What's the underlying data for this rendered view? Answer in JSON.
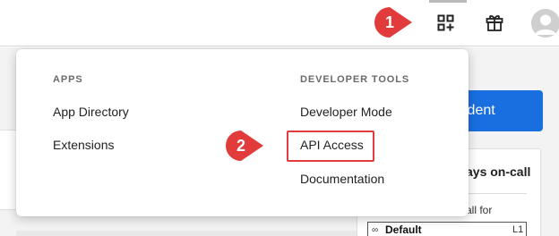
{
  "colors": {
    "accent_blue": "#1a6fe0",
    "callout_red": "#e23b3b",
    "section_gray": "#6a6a6a"
  },
  "topbar": {
    "icons": [
      "apps-add-icon",
      "gift-icon",
      "user-avatar-icon"
    ]
  },
  "menu": {
    "apps": {
      "title": "APPS",
      "items": [
        "App Directory",
        "Extensions"
      ]
    },
    "developer_tools": {
      "title": "DEVELOPER TOOLS",
      "items": [
        "Developer Mode",
        "API Access",
        "Documentation"
      ]
    }
  },
  "callouts": [
    {
      "number": "1",
      "target": "apps-add-icon"
    },
    {
      "number": "2",
      "target": "API Access"
    }
  ],
  "background": {
    "incident_button_label": "ident",
    "oncall_title": "ays on-call",
    "oncall_subtitle": "all for",
    "policy": {
      "name": "Default",
      "level": "L1"
    }
  }
}
